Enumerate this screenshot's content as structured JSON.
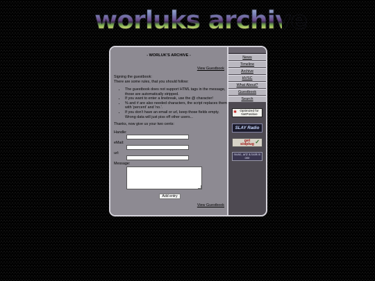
{
  "logo": {
    "text": "worluks archive"
  },
  "main": {
    "title": "- WORLUK'S ARCHIVE -",
    "view_guestbook_top": "View Guestbook",
    "intro_line1": "Signing the guestbook:",
    "intro_line2": "There are some rules, that you should follow:",
    "rules": [
      "The guestbook does not support HTML tags in the message, those are automatically stripped.",
      "If you want to enter a linebreak, use the @ character!",
      "% and # are also needed characters, the script replaces them with 'percent' and 'no.'.",
      "If you don't have an email or url, keep those fields empty. Wrong data will just piss off other users..."
    ],
    "thanks": "Thanks, now give us your two cents:",
    "form": {
      "handle_label": "Handle:",
      "email_label": "eMail:",
      "url_label": "url:",
      "message_label": "Message:",
      "handle_value": "",
      "email_value": "",
      "url_value": "",
      "message_value": "",
      "submit_label": "Add entry"
    },
    "view_guestbook_bottom": "View Guestbook"
  },
  "nav": {
    "items": [
      {
        "label": "News"
      },
      {
        "label": "Timeline"
      },
      {
        "label": "Archive"
      },
      {
        "label": "HVSC"
      },
      {
        "label": "What About?"
      },
      {
        "label": "Guestbook"
      },
      {
        "label": "Search"
      }
    ]
  },
  "badges": {
    "optimized": "Optimized for NetPositive",
    "slay": "SLAY Radio",
    "sidplug_line1": "get",
    "sidplug_line2": "sidplug",
    "art": "music, artz & tools in one"
  }
}
